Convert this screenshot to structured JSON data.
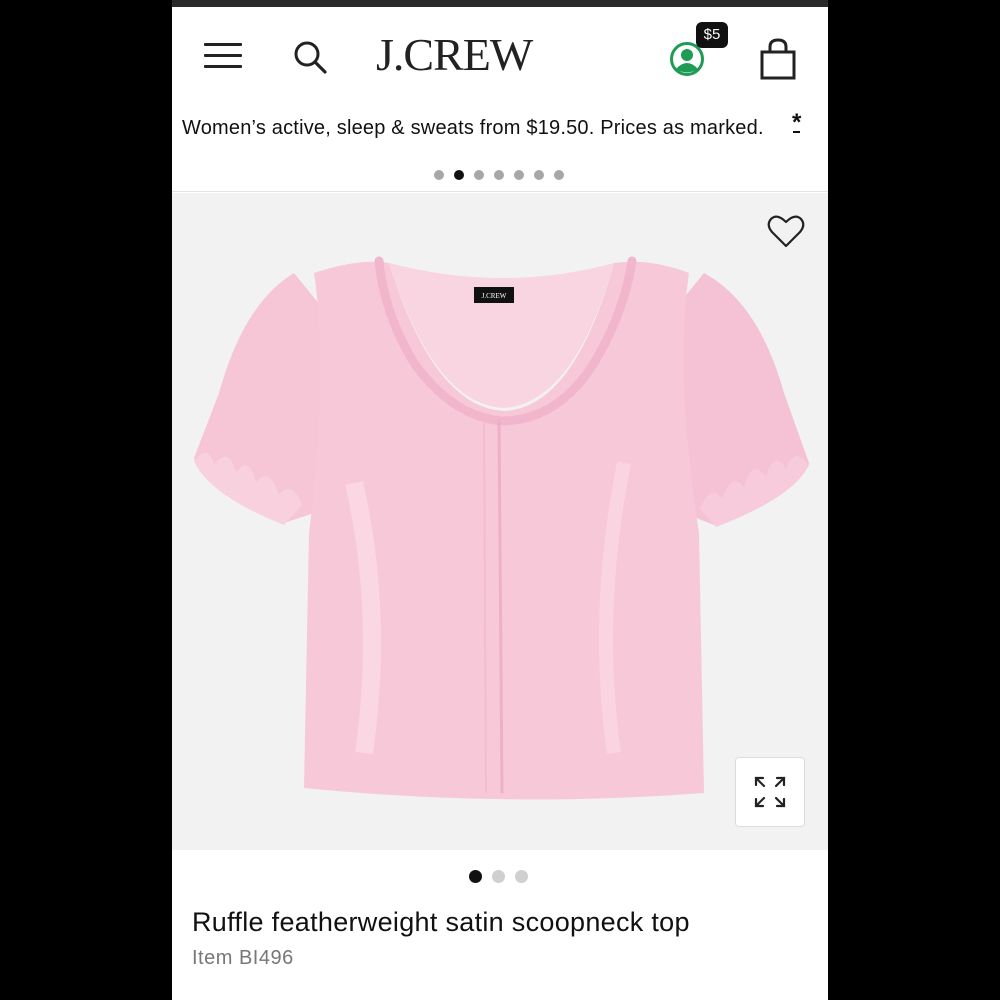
{
  "header": {
    "brand": "J.CREW",
    "rewards_badge": "$5",
    "icons": {
      "menu": "hamburger-menu-icon",
      "search": "search-icon",
      "account": "account-icon",
      "bag": "shopping-bag-icon"
    },
    "colors": {
      "account_green": "#1e9b55"
    }
  },
  "promo": {
    "text": "Women’s active, sleep & sweats from $19.50. Prices as marked.",
    "details_link": "*",
    "carousel_count": 7,
    "carousel_active_index": 1
  },
  "product": {
    "image_count": 3,
    "image_active_index": 0,
    "label_text": "J.CREW",
    "title": "Ruffle featherweight satin scoopneck top",
    "item": "Item BI496",
    "icons": {
      "wishlist": "heart-icon",
      "expand": "expand-icon"
    },
    "colors": {
      "shirt": "#f7c9d9"
    }
  }
}
